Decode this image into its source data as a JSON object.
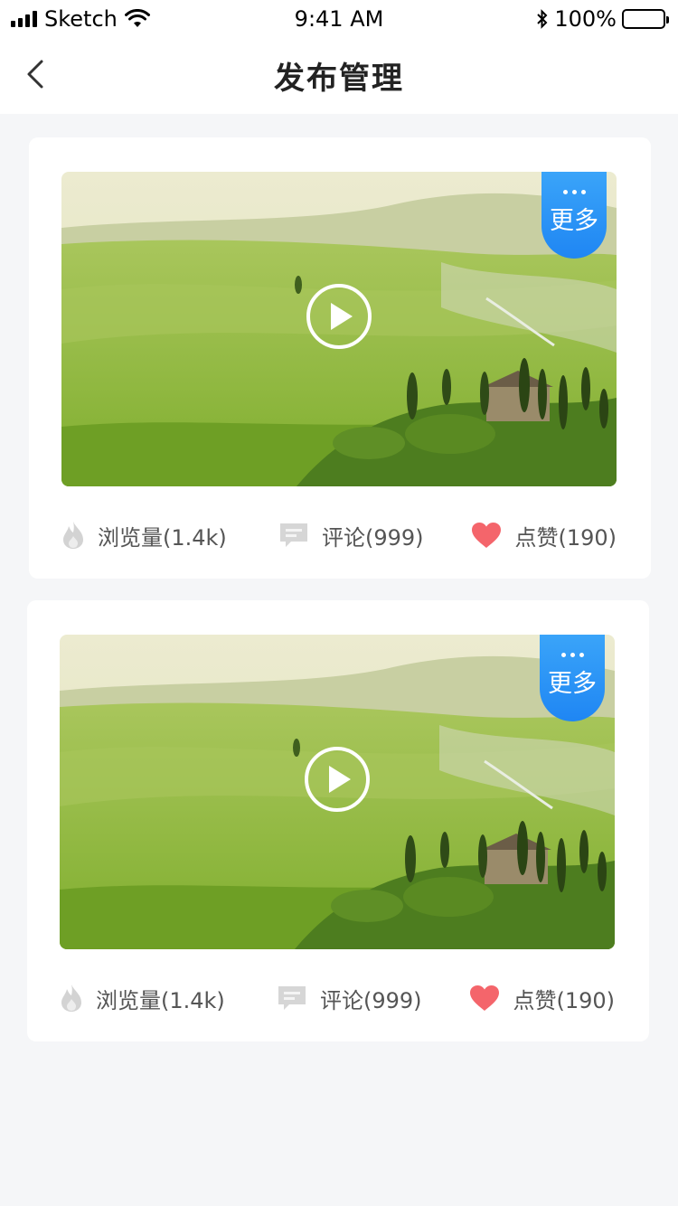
{
  "status_bar": {
    "carrier": "Sketch",
    "time": "9:41 AM",
    "battery": "100%"
  },
  "nav": {
    "title": "发布管理",
    "back_icon": "chevron-left-icon"
  },
  "posts": [
    {
      "more_label": "更多",
      "views_label": "浏览量(1.4k)",
      "comments_label": "评论(999)",
      "likes_label": "点赞(190)"
    },
    {
      "more_label": "更多",
      "views_label": "浏览量(1.4k)",
      "comments_label": "评论(999)",
      "likes_label": "点赞(190)"
    }
  ],
  "colors": {
    "accent": "#1f86f3",
    "like": "#f4656b",
    "icon_gray": "#cfcfcf"
  }
}
